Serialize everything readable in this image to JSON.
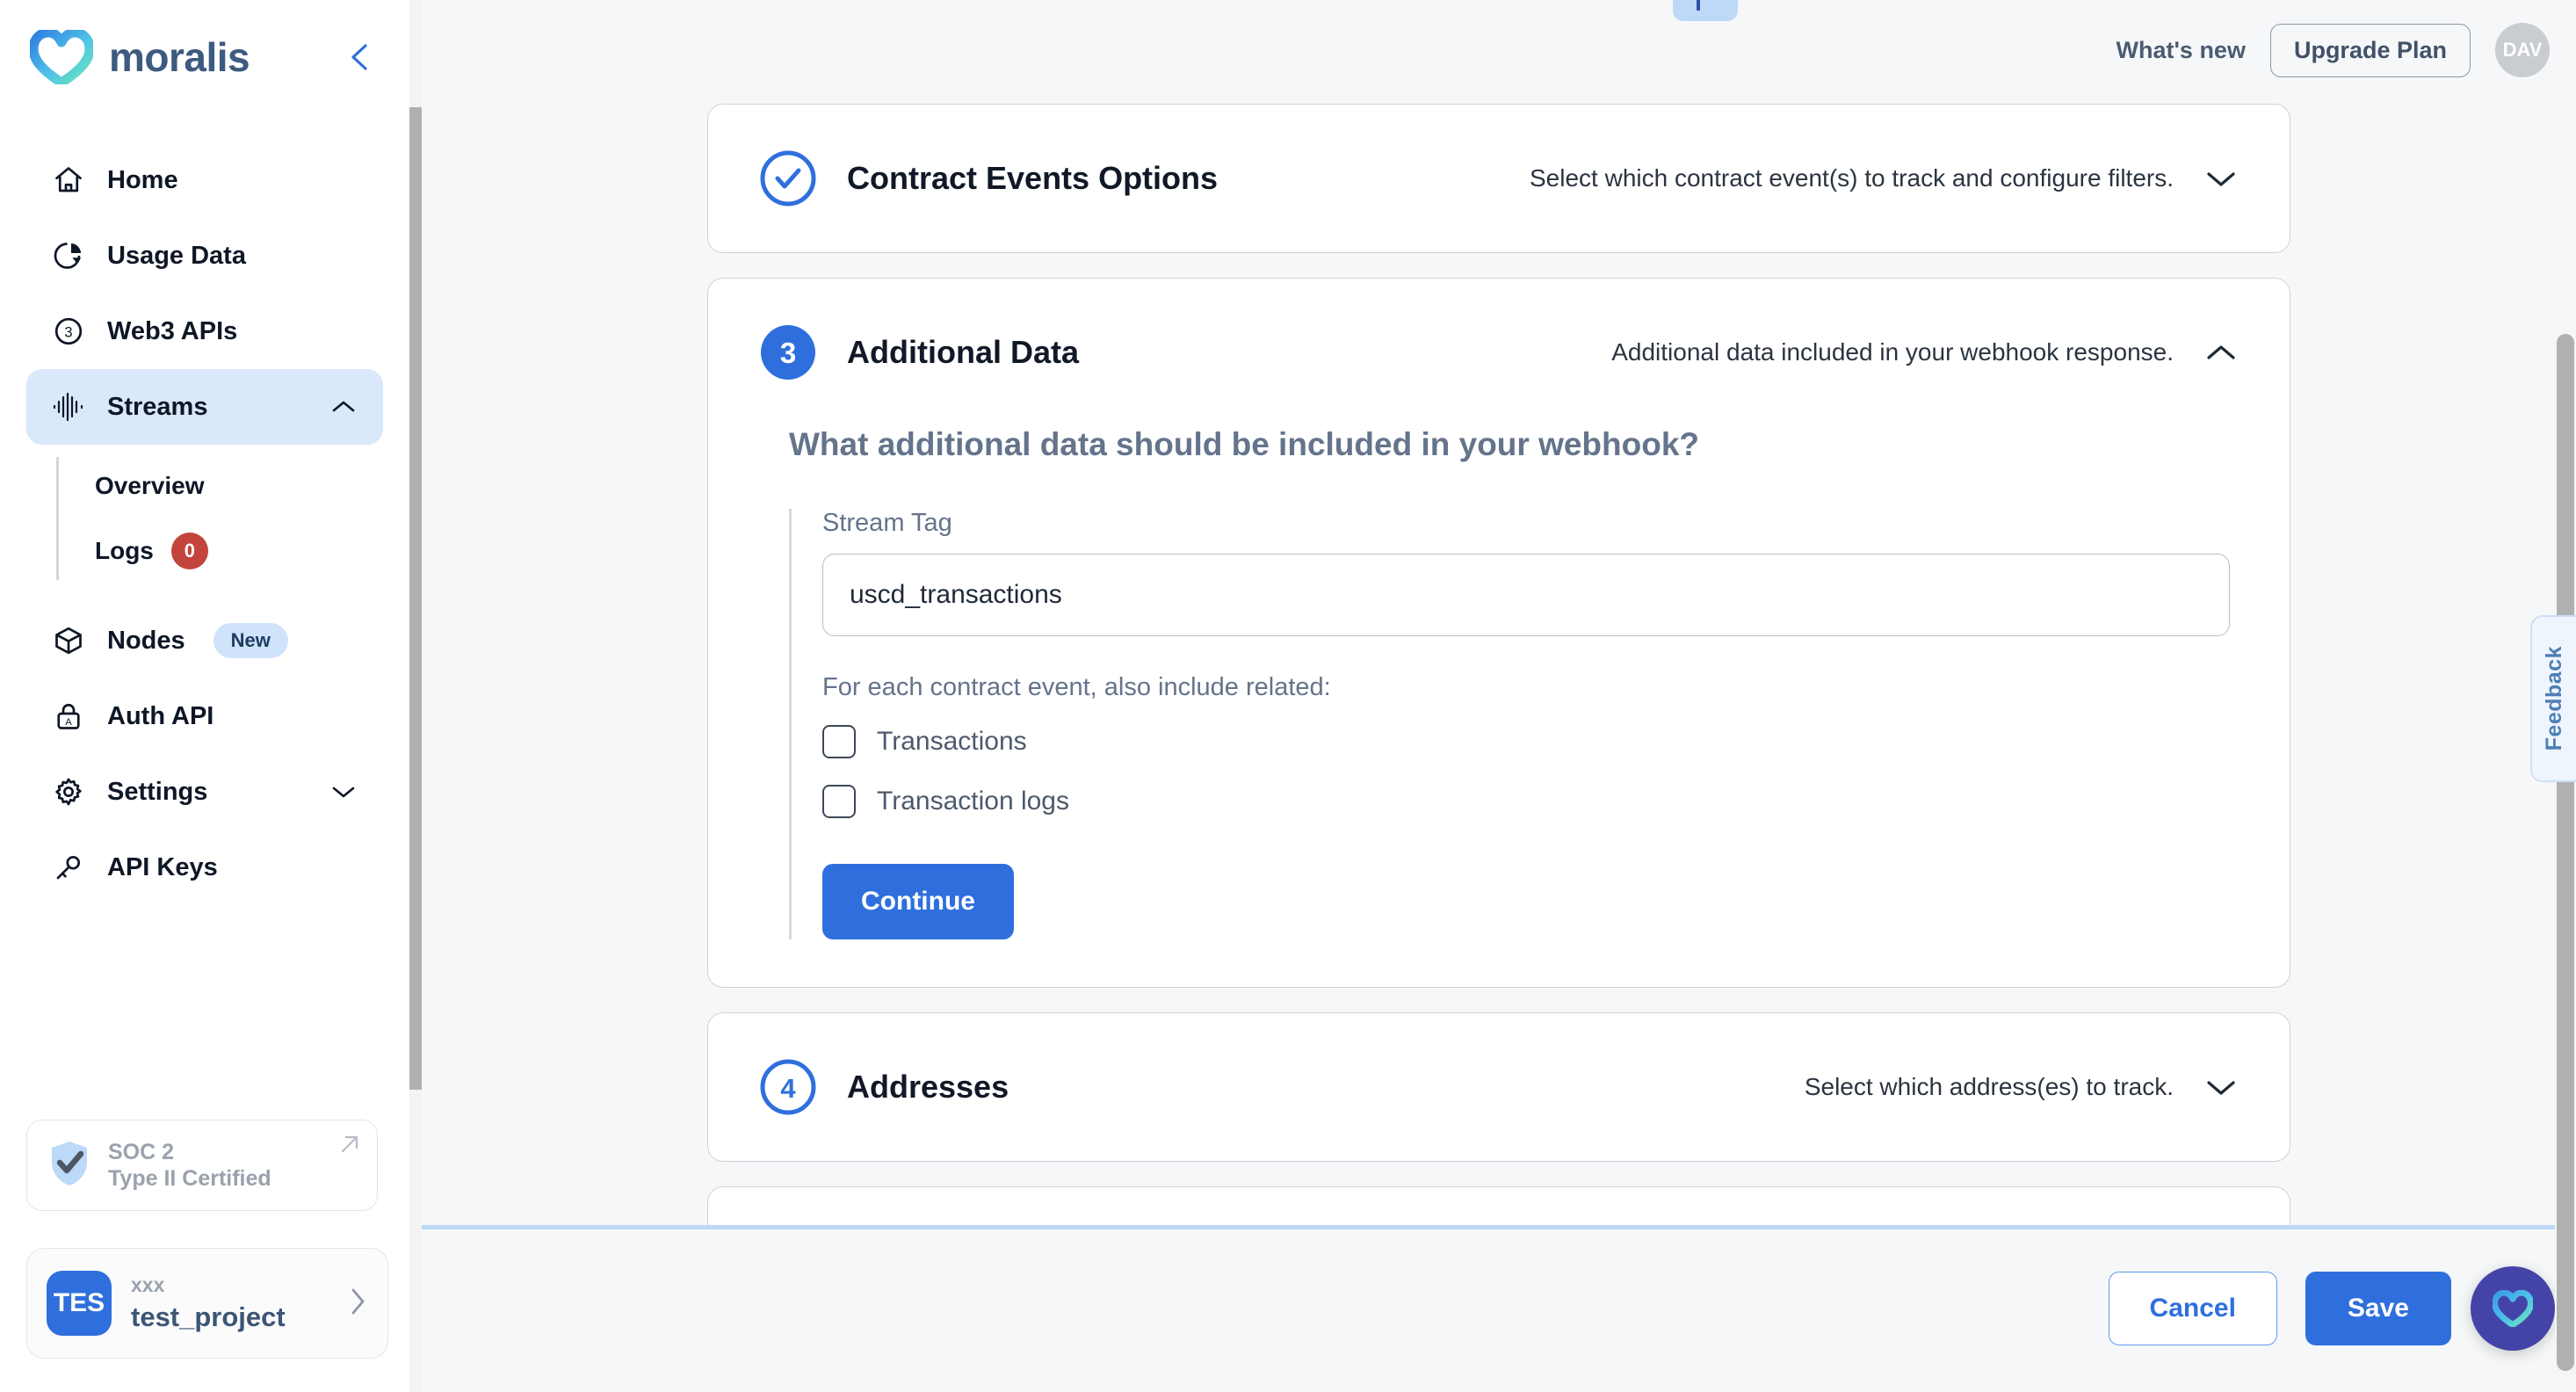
{
  "brand": {
    "name": "moralis",
    "logo_icon": "moralis-heart-logo",
    "accent": "#2f6fdd",
    "logo_gradient_from": "#2f7de0",
    "logo_gradient_to": "#6fe8b6"
  },
  "sidebar": {
    "collapse_icon": "chevron-left-icon",
    "items": [
      {
        "label": "Home",
        "icon": "home-icon",
        "active": false
      },
      {
        "label": "Usage Data",
        "icon": "pie-chart-icon",
        "active": false
      },
      {
        "label": "Web3 APIs",
        "icon": "circle-three-icon",
        "active": false
      },
      {
        "label": "Streams",
        "icon": "waveform-icon",
        "active": true,
        "chevron": "chevron-up-icon"
      },
      {
        "label": "Nodes",
        "icon": "cube-icon",
        "active": false,
        "badge": "New"
      },
      {
        "label": "Auth API",
        "icon": "lock-a-icon",
        "active": false
      },
      {
        "label": "Settings",
        "icon": "gear-icon",
        "active": false,
        "chevron": "chevron-down-icon"
      },
      {
        "label": "API Keys",
        "icon": "key-icon",
        "active": false
      }
    ],
    "sub_items": [
      {
        "label": "Overview",
        "count": null
      },
      {
        "label": "Logs",
        "count": "0",
        "count_color": "#c2443c"
      }
    ],
    "soc2": {
      "icon": "shield-check-icon",
      "line1": "SOC 2",
      "line2": "Type II Certified",
      "link_icon": "arrow-up-right-icon"
    },
    "project": {
      "avatar_initials": "TES",
      "org": "xxx",
      "name": "test_project",
      "chevron": "chevron-right-icon"
    }
  },
  "topbar": {
    "flag_icon": "flag-icon",
    "whats_new": "What's new",
    "upgrade_label": "Upgrade Plan",
    "avatar_initials": "DAV"
  },
  "steps": [
    {
      "badge_type": "check",
      "badge_icon": "check-circle-icon",
      "title": "Contract Events Options",
      "subtitle": "Select which contract event(s) to track and configure filters.",
      "chevron": "chevron-down-icon",
      "expanded": false
    },
    {
      "badge_type": "number-filled",
      "badge_number": "3",
      "title": "Additional Data",
      "subtitle": "Additional data included in your webhook response.",
      "chevron": "chevron-up-icon",
      "expanded": true
    },
    {
      "badge_type": "number-outline",
      "badge_number": "4",
      "title": "Addresses",
      "subtitle": "Select which address(es) to track.",
      "chevron": "chevron-down-icon",
      "expanded": false
    }
  ],
  "additional_data_form": {
    "question": "What additional data should be included in your webhook?",
    "stream_tag_label": "Stream Tag",
    "stream_tag_value": "uscd_transactions",
    "stream_tag_placeholder": "Stream Tag",
    "include_label": "For each contract event, also include related:",
    "checkboxes": [
      {
        "label": "Transactions",
        "checked": false
      },
      {
        "label": "Transaction logs",
        "checked": false
      }
    ],
    "continue_label": "Continue"
  },
  "footer": {
    "cancel_label": "Cancel",
    "save_label": "Save",
    "chat_icon": "moralis-chat-icon"
  },
  "feedback_tab": {
    "label": "Feedback"
  }
}
